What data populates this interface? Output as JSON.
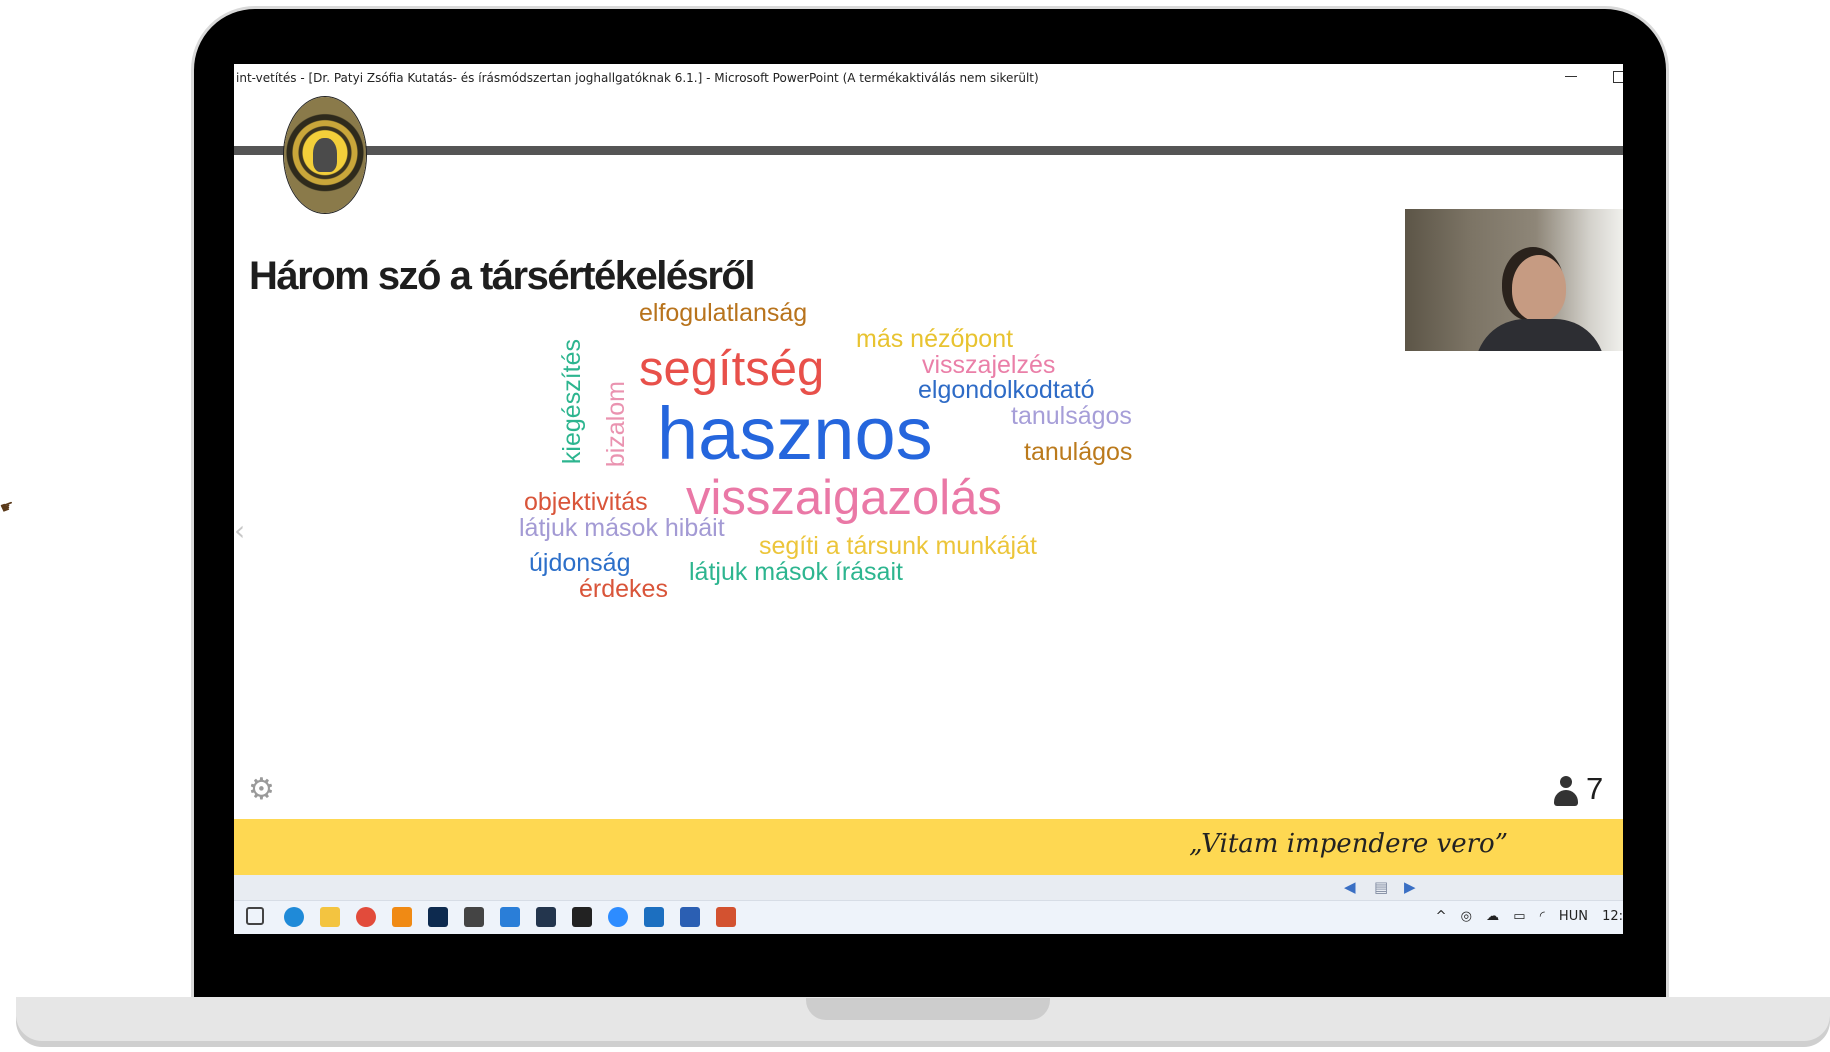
{
  "window": {
    "title": "int-vetítés - [Dr. Patyi Zsófia Kutatás- és írásmódszertan joghallgatóknak 6.1.] - Microsoft PowerPoint (A termékaktiválás nem sikerült)"
  },
  "slide": {
    "title": "Három szó a társértékelésről",
    "motto": "„Vitam impendere vero”",
    "participants_count": "7"
  },
  "wordcloud": {
    "words": [
      {
        "text": "elfogulatlanság",
        "color": "#b8731c"
      },
      {
        "text": "más nézőpont",
        "color": "#e8c330"
      },
      {
        "text": "segítség",
        "color": "#e8504a"
      },
      {
        "text": "visszajelzés",
        "color": "#ea7fa8"
      },
      {
        "text": "elgondolkodtató",
        "color": "#2e6bc6"
      },
      {
        "text": "tanulságos",
        "color": "#a69ed8"
      },
      {
        "text": "kiegészítés",
        "color": "#2db58f"
      },
      {
        "text": "bizalom",
        "color": "#ea93b0"
      },
      {
        "text": "hasznos",
        "color": "#2566dd"
      },
      {
        "text": "tanulágos",
        "color": "#bb7a1c"
      },
      {
        "text": "objektivitás",
        "color": "#d9553a"
      },
      {
        "text": "visszaigazolás",
        "color": "#ea78a6"
      },
      {
        "text": "látjuk mások hibáit",
        "color": "#a39ad4"
      },
      {
        "text": "segíti a társunk munkáját",
        "color": "#ecc53a"
      },
      {
        "text": "újdonság",
        "color": "#2c6fc9"
      },
      {
        "text": "látjuk mások írásait",
        "color": "#2db58f"
      },
      {
        "text": "érdekes",
        "color": "#d9553a"
      }
    ]
  },
  "taskbar": {
    "language": "HUN",
    "time": "12:"
  },
  "icons": {
    "gear": "gear-icon",
    "person": "person-icon",
    "prev": "chevron-left-icon"
  }
}
